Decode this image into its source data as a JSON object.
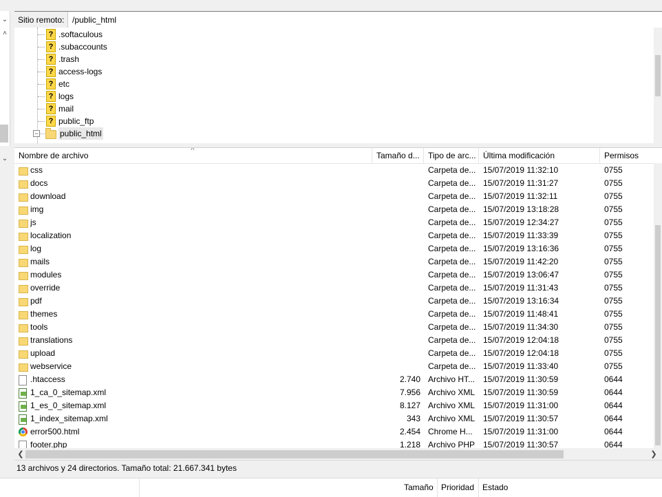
{
  "remote_site": {
    "label": "Sitio remoto:",
    "path": "/public_html"
  },
  "tree": {
    "items": [
      {
        "label": ".softaculous",
        "icon": "unknown-folder-icon"
      },
      {
        "label": ".subaccounts",
        "icon": "unknown-folder-icon"
      },
      {
        "label": ".trash",
        "icon": "unknown-folder-icon"
      },
      {
        "label": "access-logs",
        "icon": "unknown-folder-icon"
      },
      {
        "label": "etc",
        "icon": "unknown-folder-icon"
      },
      {
        "label": "logs",
        "icon": "unknown-folder-icon"
      },
      {
        "label": "mail",
        "icon": "unknown-folder-icon"
      },
      {
        "label": "public_ftp",
        "icon": "unknown-folder-icon"
      },
      {
        "label": "public_html",
        "icon": "folder-icon",
        "selected": true,
        "expanded": true
      }
    ]
  },
  "file_list": {
    "columns": {
      "name": "Nombre de archivo",
      "size": "Tamaño d...",
      "type": "Tipo de arc...",
      "modified": "Última modificación",
      "perms": "Permisos"
    },
    "rows": [
      {
        "name": "css",
        "size": "",
        "type": "Carpeta de...",
        "modified": "15/07/2019 11:32:10",
        "perms": "0755",
        "icon": "folder"
      },
      {
        "name": "docs",
        "size": "",
        "type": "Carpeta de...",
        "modified": "15/07/2019 11:31:27",
        "perms": "0755",
        "icon": "folder"
      },
      {
        "name": "download",
        "size": "",
        "type": "Carpeta de...",
        "modified": "15/07/2019 11:32:11",
        "perms": "0755",
        "icon": "folder"
      },
      {
        "name": "img",
        "size": "",
        "type": "Carpeta de...",
        "modified": "15/07/2019 13:18:28",
        "perms": "0755",
        "icon": "folder"
      },
      {
        "name": "js",
        "size": "",
        "type": "Carpeta de...",
        "modified": "15/07/2019 12:34:27",
        "perms": "0755",
        "icon": "folder"
      },
      {
        "name": "localization",
        "size": "",
        "type": "Carpeta de...",
        "modified": "15/07/2019 11:33:39",
        "perms": "0755",
        "icon": "folder"
      },
      {
        "name": "log",
        "size": "",
        "type": "Carpeta de...",
        "modified": "15/07/2019 13:16:36",
        "perms": "0755",
        "icon": "folder"
      },
      {
        "name": "mails",
        "size": "",
        "type": "Carpeta de...",
        "modified": "15/07/2019 11:42:20",
        "perms": "0755",
        "icon": "folder"
      },
      {
        "name": "modules",
        "size": "",
        "type": "Carpeta de...",
        "modified": "15/07/2019 13:06:47",
        "perms": "0755",
        "icon": "folder"
      },
      {
        "name": "override",
        "size": "",
        "type": "Carpeta de...",
        "modified": "15/07/2019 11:31:43",
        "perms": "0755",
        "icon": "folder"
      },
      {
        "name": "pdf",
        "size": "",
        "type": "Carpeta de...",
        "modified": "15/07/2019 13:16:34",
        "perms": "0755",
        "icon": "folder"
      },
      {
        "name": "themes",
        "size": "",
        "type": "Carpeta de...",
        "modified": "15/07/2019 11:48:41",
        "perms": "0755",
        "icon": "folder"
      },
      {
        "name": "tools",
        "size": "",
        "type": "Carpeta de...",
        "modified": "15/07/2019 11:34:30",
        "perms": "0755",
        "icon": "folder"
      },
      {
        "name": "translations",
        "size": "",
        "type": "Carpeta de...",
        "modified": "15/07/2019 12:04:18",
        "perms": "0755",
        "icon": "folder"
      },
      {
        "name": "upload",
        "size": "",
        "type": "Carpeta de...",
        "modified": "15/07/2019 12:04:18",
        "perms": "0755",
        "icon": "folder"
      },
      {
        "name": "webservice",
        "size": "",
        "type": "Carpeta de...",
        "modified": "15/07/2019 11:33:40",
        "perms": "0755",
        "icon": "folder"
      },
      {
        "name": ".htaccess",
        "size": "2.740",
        "type": "Archivo HT...",
        "modified": "15/07/2019 11:30:59",
        "perms": "0644",
        "icon": "file"
      },
      {
        "name": "1_ca_0_sitemap.xml",
        "size": "7.956",
        "type": "Archivo XML",
        "modified": "15/07/2019 11:30:59",
        "perms": "0644",
        "icon": "xml"
      },
      {
        "name": "1_es_0_sitemap.xml",
        "size": "8.127",
        "type": "Archivo XML",
        "modified": "15/07/2019 11:31:00",
        "perms": "0644",
        "icon": "xml"
      },
      {
        "name": "1_index_sitemap.xml",
        "size": "343",
        "type": "Archivo XML",
        "modified": "15/07/2019 11:30:57",
        "perms": "0644",
        "icon": "xml"
      },
      {
        "name": "error500.html",
        "size": "2.454",
        "type": "Chrome H...",
        "modified": "15/07/2019 11:31:00",
        "perms": "0644",
        "icon": "chrome"
      },
      {
        "name": "footer.php",
        "size": "1.218",
        "type": "Archivo PHP",
        "modified": "15/07/2019 11:30:57",
        "perms": "0644",
        "icon": "php"
      }
    ]
  },
  "status": {
    "text": "13 archivos y 24 directorios. Tamaño total: 21.667.341 bytes"
  },
  "queue": {
    "columns": [
      "Tamaño",
      "Prioridad",
      "Estado"
    ]
  }
}
